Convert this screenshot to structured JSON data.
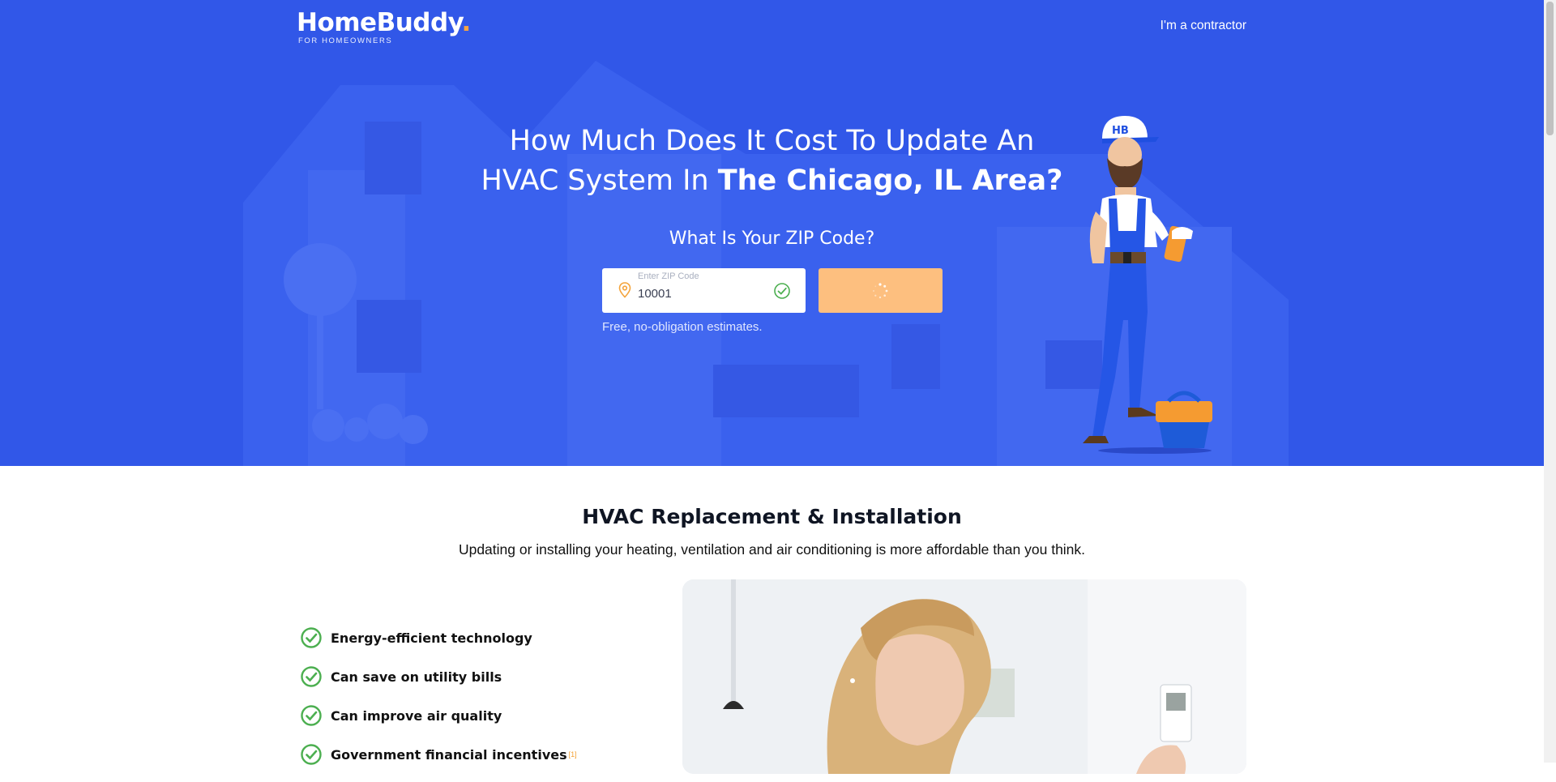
{
  "header": {
    "logo_name": "HomeBuddy",
    "logo_dot": ".",
    "logo_sub": "FOR HOMEOWNERS",
    "contractor_link": "I'm a contractor"
  },
  "hero": {
    "headline_line1": "How Much Does It Cost To Update An",
    "headline_line2_prefix": "HVAC System In ",
    "headline_line2_bold": "The Chicago, IL Area?",
    "zip_question": "What Is Your ZIP Code?",
    "zip_label": "Enter ZIP Code",
    "zip_value": "10001",
    "free_note": "Free, no-obligation estimates.",
    "mascot_cap_text": "HB"
  },
  "section": {
    "title": "HVAC Replacement & Installation",
    "subtitle": "Updating or installing your heating, ventilation and air conditioning is more affordable than you think.",
    "benefits": [
      {
        "label": "Energy-efficient technology"
      },
      {
        "label": "Can save on utility bills"
      },
      {
        "label": "Can improve air quality"
      },
      {
        "label": "Government financial incentives",
        "footnote": "[1]"
      }
    ]
  },
  "colors": {
    "hero_bg": "#3157e8",
    "accent_orange": "#f7a541",
    "button_bg": "#fdbf7f",
    "check_green": "#4caf50"
  },
  "icons": [
    "location-pin-icon",
    "check-circle-icon",
    "loading-spinner-icon"
  ]
}
